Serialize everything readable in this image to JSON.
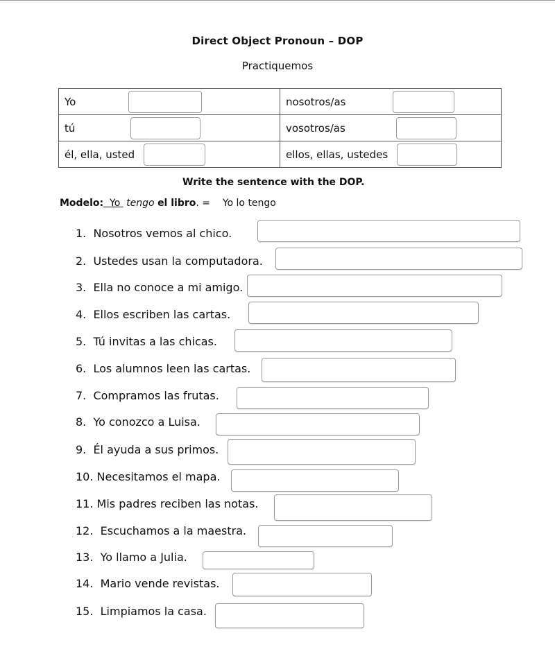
{
  "worksheet": {
    "title": "Direct Object Pronoun – DOP",
    "subtitle": "Practiquemos",
    "pronoun_table": {
      "rows": [
        {
          "left_label": "Yo",
          "left_value": "",
          "right_label": "nosotros/as",
          "right_value": ""
        },
        {
          "left_label": "tú",
          "left_value": "",
          "right_label": "vosotros/as",
          "right_value": ""
        },
        {
          "left_label": "él, ella, usted",
          "left_value": "",
          "right_label": "ellos, ellas, ustedes",
          "right_value": ""
        }
      ]
    },
    "instruction": "Write the sentence with the DOP.",
    "model": {
      "label": "Modelo:",
      "subject": "Yo",
      "verb": "tengo",
      "object": "el libro",
      "period": ".",
      "equals": " =",
      "answer": "Yo lo tengo"
    },
    "items": [
      {
        "text": "1.  Nosotros vemos al chico.",
        "answer": ""
      },
      {
        "text": "2.  Ustedes usan la computadora.",
        "answer": ""
      },
      {
        "text": "3.  Ella no conoce a mi amigo.",
        "answer": ""
      },
      {
        "text": "4.  Ellos escriben las cartas.",
        "answer": ""
      },
      {
        "text": "5.  Tú invitas a las chicas.",
        "answer": ""
      },
      {
        "text": "6.  Los alumnos leen las cartas.",
        "answer": ""
      },
      {
        "text": "7.  Compramos las frutas.",
        "answer": ""
      },
      {
        "text": "8.  Yo conozco a Luisa.",
        "answer": ""
      },
      {
        "text": "9.  Él ayuda a sus primos.",
        "answer": ""
      },
      {
        "text": "10. Necesitamos el mapa.",
        "answer": ""
      },
      {
        "text": "11. Mis padres reciben las notas.",
        "answer": ""
      },
      {
        "text": "12.  Escuchamos a la maestra.",
        "answer": ""
      },
      {
        "text": "13.  Yo llamo a Julia.",
        "answer": ""
      },
      {
        "text": "14.  Mario vende revistas.",
        "answer": ""
      },
      {
        "text": "15.  Limpiamos la casa.",
        "answer": ""
      }
    ]
  }
}
